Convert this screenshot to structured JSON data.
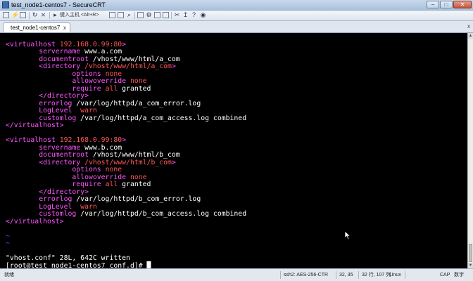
{
  "window": {
    "title": "test_node1-centos7 - SecureCRT",
    "minimize": "–",
    "maximize": "□",
    "close": "✕"
  },
  "toolbar": {
    "host_placeholder": "键入主机 <Alt+R>",
    "icons": [
      "connect-icon",
      "quick-connect-icon",
      "connect-tab-icon",
      "reconnect-icon",
      "disconnect-icon",
      "copy-icon",
      "paste-icon",
      "find-icon",
      "print-icon",
      "settings-icon",
      "keymap-icon",
      "sftp-icon",
      "tools-icon",
      "help-icon",
      "globe-icon"
    ]
  },
  "tabs": [
    {
      "label": "test_node1-centos7",
      "close": "x",
      "active": true
    }
  ],
  "tab_close_all": "x",
  "terminal": {
    "lines": [
      {
        "segments": []
      },
      {
        "segments": [
          {
            "text": "<virtualhost ",
            "c": "mag"
          },
          {
            "text": "192.168.0.99:80",
            "c": "red"
          },
          {
            "text": ">",
            "c": "mag"
          }
        ]
      },
      {
        "segments": [
          {
            "text": "        "
          },
          {
            "text": "servername",
            "c": "mag"
          },
          {
            "text": " www.a.com",
            "c": "def"
          }
        ]
      },
      {
        "segments": [
          {
            "text": "        "
          },
          {
            "text": "documentroot",
            "c": "mag"
          },
          {
            "text": " /vhost/www/html/a_com",
            "c": "def"
          }
        ]
      },
      {
        "segments": [
          {
            "text": "        "
          },
          {
            "text": "<directory ",
            "c": "mag"
          },
          {
            "text": "/vhost/www/html/a_com",
            "c": "red"
          },
          {
            "text": ">",
            "c": "mag"
          }
        ]
      },
      {
        "segments": [
          {
            "text": "                "
          },
          {
            "text": "options",
            "c": "mag"
          },
          {
            "text": " none",
            "c": "red"
          }
        ]
      },
      {
        "segments": [
          {
            "text": "                "
          },
          {
            "text": "allowoverride",
            "c": "mag"
          },
          {
            "text": " none",
            "c": "red"
          }
        ]
      },
      {
        "segments": [
          {
            "text": "                "
          },
          {
            "text": "require",
            "c": "mag"
          },
          {
            "text": " all",
            "c": "red"
          },
          {
            "text": " granted",
            "c": "def"
          }
        ]
      },
      {
        "segments": [
          {
            "text": "        "
          },
          {
            "text": "</directory>",
            "c": "mag"
          }
        ]
      },
      {
        "segments": [
          {
            "text": "        "
          },
          {
            "text": "errorlog",
            "c": "mag"
          },
          {
            "text": " /var/log/httpd/a_com_error.log",
            "c": "def"
          }
        ]
      },
      {
        "segments": [
          {
            "text": "        "
          },
          {
            "text": "LogLevel",
            "c": "mag"
          },
          {
            "text": "  warn",
            "c": "red"
          }
        ]
      },
      {
        "segments": [
          {
            "text": "        "
          },
          {
            "text": "customlog",
            "c": "mag"
          },
          {
            "text": " /var/log/httpd/a_com_access.log combined",
            "c": "def"
          }
        ]
      },
      {
        "segments": [
          {
            "text": "</virtualhost>",
            "c": "mag"
          }
        ]
      },
      {
        "segments": []
      },
      {
        "segments": [
          {
            "text": "<virtualhost ",
            "c": "mag"
          },
          {
            "text": "192.168.0.99:80",
            "c": "red"
          },
          {
            "text": ">",
            "c": "mag"
          }
        ]
      },
      {
        "segments": [
          {
            "text": "        "
          },
          {
            "text": "servername",
            "c": "mag"
          },
          {
            "text": " www.b.com",
            "c": "def"
          }
        ]
      },
      {
        "segments": [
          {
            "text": "        "
          },
          {
            "text": "documentroot",
            "c": "mag"
          },
          {
            "text": " /vhost/www/html/b_com",
            "c": "def"
          }
        ]
      },
      {
        "segments": [
          {
            "text": "        "
          },
          {
            "text": "<directory ",
            "c": "mag"
          },
          {
            "text": "/vhost/www/html/b_com",
            "c": "red"
          },
          {
            "text": ">",
            "c": "mag"
          }
        ]
      },
      {
        "segments": [
          {
            "text": "                "
          },
          {
            "text": "options",
            "c": "mag"
          },
          {
            "text": " none",
            "c": "red"
          }
        ]
      },
      {
        "segments": [
          {
            "text": "                "
          },
          {
            "text": "allowoverride",
            "c": "mag"
          },
          {
            "text": " none",
            "c": "red"
          }
        ]
      },
      {
        "segments": [
          {
            "text": "                "
          },
          {
            "text": "require",
            "c": "mag"
          },
          {
            "text": " all",
            "c": "red"
          },
          {
            "text": " granted",
            "c": "def"
          }
        ]
      },
      {
        "segments": [
          {
            "text": "        "
          },
          {
            "text": "</directory>",
            "c": "mag"
          }
        ]
      },
      {
        "segments": [
          {
            "text": "        "
          },
          {
            "text": "errorlog",
            "c": "mag"
          },
          {
            "text": " /var/log/httpd/b_com_error.log",
            "c": "def"
          }
        ]
      },
      {
        "segments": [
          {
            "text": "        "
          },
          {
            "text": "LogLevel",
            "c": "mag"
          },
          {
            "text": "  warn",
            "c": "red"
          }
        ]
      },
      {
        "segments": [
          {
            "text": "        "
          },
          {
            "text": "customlog",
            "c": "mag"
          },
          {
            "text": " /var/log/httpd/b_com_access.log combined",
            "c": "def"
          }
        ]
      },
      {
        "segments": [
          {
            "text": "</virtualhost>",
            "c": "mag"
          }
        ]
      },
      {
        "segments": []
      },
      {
        "segments": [
          {
            "text": "~",
            "c": "blue"
          }
        ]
      },
      {
        "segments": [
          {
            "text": "~",
            "c": "blue"
          }
        ]
      },
      {
        "segments": []
      },
      {
        "segments": [
          {
            "text": "\"vhost.conf\" 28L, 642C written",
            "c": "def"
          }
        ]
      },
      {
        "segments": [
          {
            "text": "[root@test_node1-centos7 conf.d]# ",
            "c": "def"
          },
          {
            "text": "█",
            "c": "def"
          }
        ]
      }
    ]
  },
  "statusbar": {
    "ready": "就绪",
    "protocol": "ssh2: AES-256-CTR",
    "position": "32,  35",
    "size": "32 行, 107 列",
    "os": "Linux",
    "caps": "CAP",
    "num": "数字"
  },
  "colors": {
    "magenta": "#ff55ff",
    "red": "#ff5555",
    "blue": "#5555ff",
    "white": "#ffffff",
    "terminal_bg": "#000000"
  }
}
